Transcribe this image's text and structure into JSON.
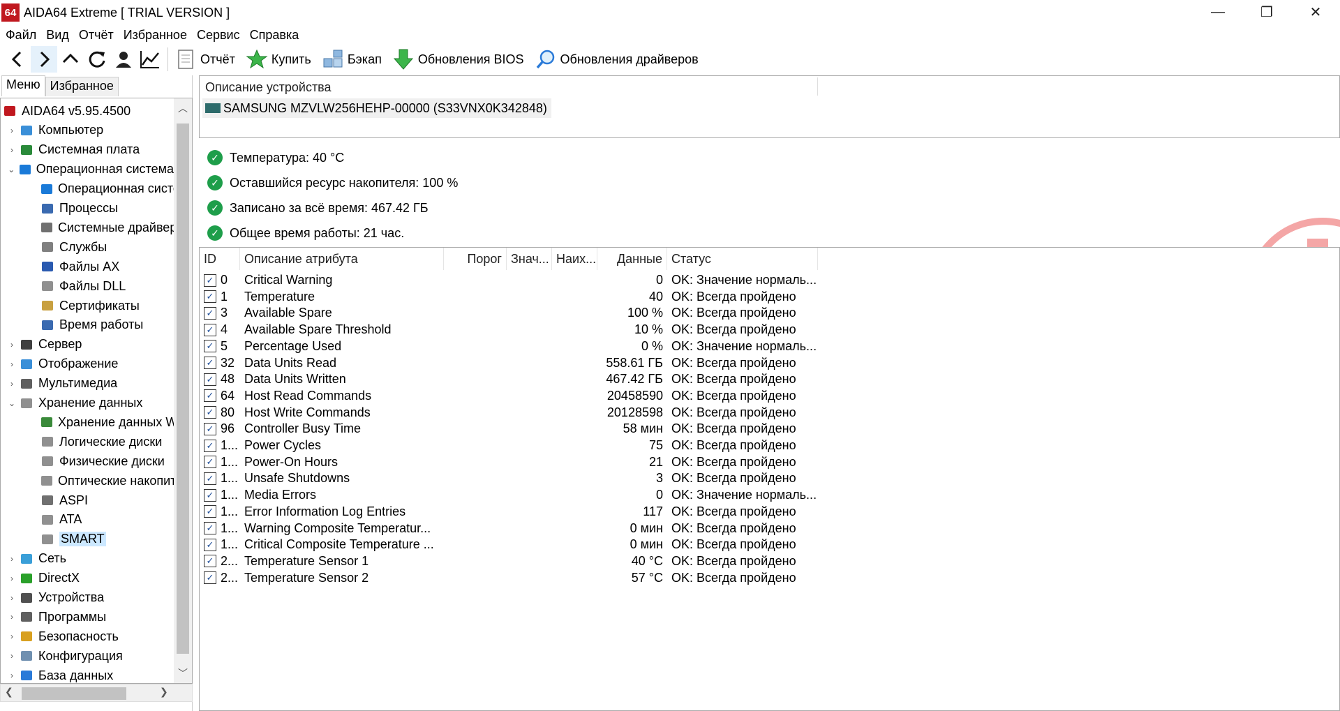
{
  "window": {
    "logo": "64",
    "title": "AIDA64 Extreme  [ TRIAL VERSION ]",
    "controls": {
      "minimize": "—",
      "restore": "❐",
      "close": "✕"
    }
  },
  "menubar": [
    "Файл",
    "Вид",
    "Отчёт",
    "Избранное",
    "Сервис",
    "Справка"
  ],
  "toolbar": {
    "nav_icons": [
      "back-arrow-icon",
      "forward-arrow-icon",
      "up-arrow-icon",
      "refresh-icon",
      "user-icon",
      "chart-icon"
    ],
    "buttons": [
      {
        "label": "Отчёт",
        "icon": "report-icon"
      },
      {
        "label": "Купить",
        "icon": "buy-star-icon"
      },
      {
        "label": "Бэкап",
        "icon": "backup-icon"
      },
      {
        "label": "Обновления BIOS",
        "icon": "bios-update-icon"
      },
      {
        "label": "Обновления драйверов",
        "icon": "driver-update-icon"
      }
    ]
  },
  "left": {
    "tabs": [
      "Меню",
      "Избранное"
    ],
    "tree": [
      {
        "label": "AIDA64 v5.95.4500",
        "level": 0,
        "exp": "",
        "icon": "aida-icon",
        "color": "#c0181f"
      },
      {
        "label": "Компьютер",
        "level": 1,
        "exp": "›",
        "icon": "computer-icon",
        "color": "#3a8fd8"
      },
      {
        "label": "Системная плата",
        "level": 1,
        "exp": "›",
        "icon": "motherboard-icon",
        "color": "#2a8a3a"
      },
      {
        "label": "Операционная система",
        "level": 1,
        "exp": "⌄",
        "icon": "windows-icon",
        "color": "#1a7ad8"
      },
      {
        "label": "Операционная система",
        "level": 2,
        "exp": "",
        "icon": "windows-icon",
        "color": "#1a7ad8"
      },
      {
        "label": "Процессы",
        "level": 2,
        "exp": "",
        "icon": "process-icon",
        "color": "#3a6ab0"
      },
      {
        "label": "Системные драйверы",
        "level": 2,
        "exp": "",
        "icon": "driver-icon",
        "color": "#707070"
      },
      {
        "label": "Службы",
        "level": 2,
        "exp": "",
        "icon": "services-icon",
        "color": "#808080"
      },
      {
        "label": "Файлы AX",
        "level": 2,
        "exp": "",
        "icon": "file-ax-icon",
        "color": "#2a5ab0"
      },
      {
        "label": "Файлы DLL",
        "level": 2,
        "exp": "",
        "icon": "file-dll-icon",
        "color": "#909090"
      },
      {
        "label": "Сертификаты",
        "level": 2,
        "exp": "",
        "icon": "certificate-icon",
        "color": "#c8a040"
      },
      {
        "label": "Время работы",
        "level": 2,
        "exp": "",
        "icon": "clock-icon",
        "color": "#3a6ab0"
      },
      {
        "label": "Сервер",
        "level": 1,
        "exp": "›",
        "icon": "server-icon",
        "color": "#404040"
      },
      {
        "label": "Отображение",
        "level": 1,
        "exp": "›",
        "icon": "display-icon",
        "color": "#3a8fd8"
      },
      {
        "label": "Мультимедиа",
        "level": 1,
        "exp": "›",
        "icon": "multimedia-icon",
        "color": "#606060"
      },
      {
        "label": "Хранение данных",
        "level": 1,
        "exp": "⌄",
        "icon": "storage-icon",
        "color": "#909090"
      },
      {
        "label": "Хранение данных Windows",
        "level": 2,
        "exp": "",
        "icon": "storage-win-icon",
        "color": "#3a8a3a"
      },
      {
        "label": "Логические диски",
        "level": 2,
        "exp": "",
        "icon": "logical-disk-icon",
        "color": "#909090"
      },
      {
        "label": "Физические диски",
        "level": 2,
        "exp": "",
        "icon": "physical-disk-icon",
        "color": "#909090"
      },
      {
        "label": "Оптические накопители",
        "level": 2,
        "exp": "",
        "icon": "optical-drive-icon",
        "color": "#909090"
      },
      {
        "label": "ASPI",
        "level": 2,
        "exp": "",
        "icon": "aspi-icon",
        "color": "#707070"
      },
      {
        "label": "ATA",
        "level": 2,
        "exp": "",
        "icon": "ata-icon",
        "color": "#909090"
      },
      {
        "label": "SMART",
        "level": 2,
        "exp": "",
        "icon": "smart-icon",
        "color": "#909090",
        "selected": true
      },
      {
        "label": "Сеть",
        "level": 1,
        "exp": "›",
        "icon": "network-icon",
        "color": "#3a9fd8"
      },
      {
        "label": "DirectX",
        "level": 1,
        "exp": "›",
        "icon": "directx-icon",
        "color": "#2aa02a"
      },
      {
        "label": "Устройства",
        "level": 1,
        "exp": "›",
        "icon": "devices-icon",
        "color": "#505050"
      },
      {
        "label": "Программы",
        "level": 1,
        "exp": "›",
        "icon": "programs-icon",
        "color": "#606060"
      },
      {
        "label": "Безопасность",
        "level": 1,
        "exp": "›",
        "icon": "security-shield-icon",
        "color": "#d8a020"
      },
      {
        "label": "Конфигурация",
        "level": 1,
        "exp": "›",
        "icon": "config-icon",
        "color": "#7090b0"
      },
      {
        "label": "База данных",
        "level": 1,
        "exp": "›",
        "icon": "database-icon",
        "color": "#2a7ad8"
      }
    ]
  },
  "device": {
    "header": "Описание устройства",
    "name": "SAMSUNG MZVLW256HEHP-00000 (S33VNX0K342848)"
  },
  "health": [
    "Температура: 40 °C",
    "Оставшийся ресурс накопителя: 100 %",
    "Записано за всё время: 467.42 ГБ",
    "Общее время работы: 21 час."
  ],
  "table": {
    "headers": [
      "ID",
      "Описание атрибута",
      "Порог",
      "Знач...",
      "Наих...",
      "Данные",
      "Статус"
    ],
    "rows": [
      {
        "id": "0",
        "desc": "Critical Warning",
        "data": "0",
        "status": "OK: Значение нормаль..."
      },
      {
        "id": "1",
        "desc": "Temperature",
        "data": "40",
        "status": "OK: Всегда пройдено"
      },
      {
        "id": "3",
        "desc": "Available Spare",
        "data": "100 %",
        "status": "OK: Всегда пройдено"
      },
      {
        "id": "4",
        "desc": "Available Spare Threshold",
        "data": "10 %",
        "status": "OK: Всегда пройдено"
      },
      {
        "id": "5",
        "desc": "Percentage Used",
        "data": "0 %",
        "status": "OK: Значение нормаль..."
      },
      {
        "id": "32",
        "desc": "Data Units Read",
        "data": "558.61 ГБ",
        "status": "OK: Всегда пройдено"
      },
      {
        "id": "48",
        "desc": "Data Units Written",
        "data": "467.42 ГБ",
        "status": "OK: Всегда пройдено"
      },
      {
        "id": "64",
        "desc": "Host Read Commands",
        "data": "20458590",
        "status": "OK: Всегда пройдено"
      },
      {
        "id": "80",
        "desc": "Host Write Commands",
        "data": "20128598",
        "status": "OK: Всегда пройдено"
      },
      {
        "id": "96",
        "desc": "Controller Busy Time",
        "data": "58 мин",
        "status": "OK: Всегда пройдено"
      },
      {
        "id": "1...",
        "desc": "Power Cycles",
        "data": "75",
        "status": "OK: Всегда пройдено"
      },
      {
        "id": "1...",
        "desc": "Power-On Hours",
        "data": "21",
        "status": "OK: Всегда пройдено"
      },
      {
        "id": "1...",
        "desc": "Unsafe Shutdowns",
        "data": "3",
        "status": "OK: Всегда пройдено"
      },
      {
        "id": "1...",
        "desc": "Media Errors",
        "data": "0",
        "status": "OK: Значение нормаль..."
      },
      {
        "id": "1...",
        "desc": "Error Information Log Entries",
        "data": "117",
        "status": "OK: Всегда пройдено"
      },
      {
        "id": "1...",
        "desc": "Warning Composite Temperatur...",
        "data": "0 мин",
        "status": "OK: Всегда пройдено"
      },
      {
        "id": "1...",
        "desc": "Critical Composite Temperature ...",
        "data": "0 мин",
        "status": "OK: Всегда пройдено"
      },
      {
        "id": "2...",
        "desc": "Temperature Sensor 1",
        "data": "40 °C",
        "status": "OK: Всегда пройдено"
      },
      {
        "id": "2...",
        "desc": "Temperature Sensor 2",
        "data": "57 °C",
        "status": "OK: Всегда пройдено"
      }
    ]
  },
  "colors": {
    "accent": "#c0181f",
    "ok_green": "#1e9e4a",
    "selection": "#cce8ff",
    "watermark": "#f4a6a6"
  }
}
